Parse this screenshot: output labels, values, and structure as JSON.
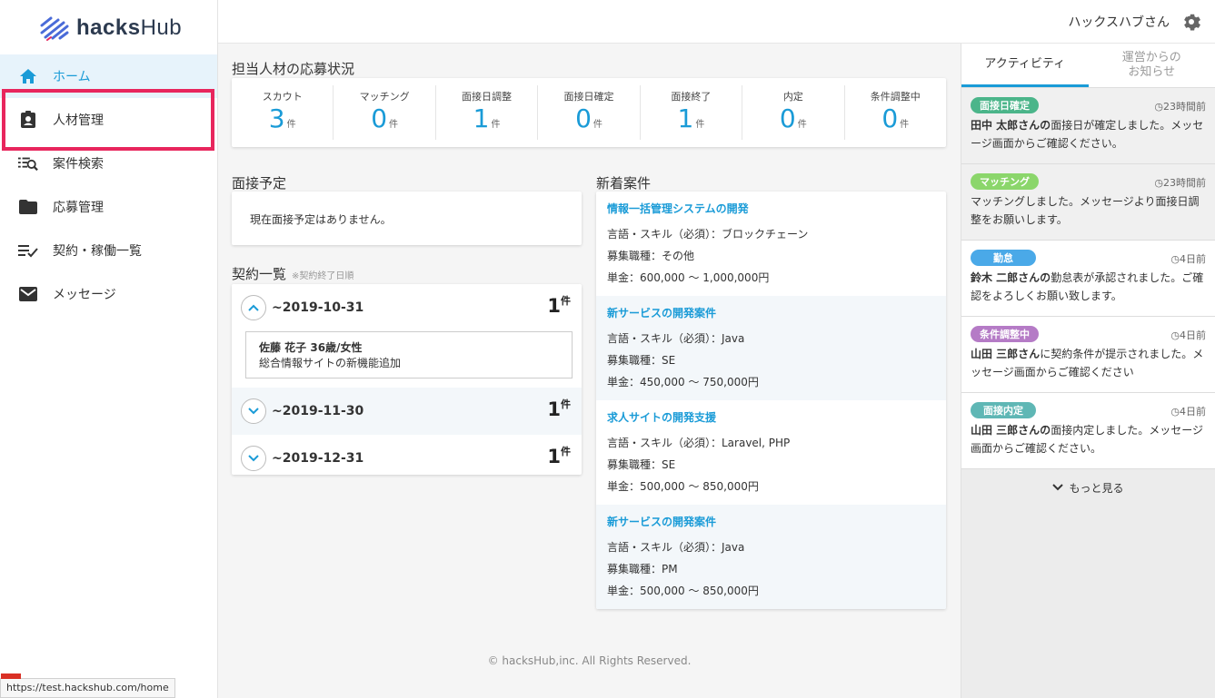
{
  "brand": {
    "name_bold": "hacks",
    "name_rest": "Hub"
  },
  "nav": [
    {
      "label": "ホーム",
      "icon": "home-icon",
      "active": true
    },
    {
      "label": "人材管理",
      "icon": "badge-icon"
    },
    {
      "label": "案件検索",
      "icon": "list-search-icon"
    },
    {
      "label": "応募管理",
      "icon": "folder-icon"
    },
    {
      "label": "契約・稼働一覧",
      "icon": "checklist-icon"
    },
    {
      "label": "メッセージ",
      "icon": "mail-icon"
    }
  ],
  "header": {
    "user": "ハックスハブさん"
  },
  "status": {
    "title": "担当人材の応募状況",
    "unit": "件",
    "items": [
      {
        "label": "スカウト",
        "value": "3"
      },
      {
        "label": "マッチング",
        "value": "0"
      },
      {
        "label": "面接日調整",
        "value": "1"
      },
      {
        "label": "面接日確定",
        "value": "0"
      },
      {
        "label": "面接終了",
        "value": "1"
      },
      {
        "label": "内定",
        "value": "0"
      },
      {
        "label": "条件調整中",
        "value": "0"
      }
    ]
  },
  "interview": {
    "title": "面接予定",
    "empty": "現在面接予定はありません。"
  },
  "contracts": {
    "title": "契約一覧",
    "note": "※契約終了日順",
    "unit": "件",
    "rows": [
      {
        "date": "~2019-10-31",
        "count": "1",
        "expanded": true,
        "detail_name": "佐藤 花子 36歳/女性",
        "detail_project": "総合情報サイトの新機能追加"
      },
      {
        "date": "~2019-11-30",
        "count": "1",
        "expanded": false
      },
      {
        "date": "~2019-12-31",
        "count": "1",
        "expanded": false
      }
    ]
  },
  "jobs": {
    "title": "新着案件",
    "items": [
      {
        "title": "情報一括管理システムの開発",
        "skill": "言語・スキル（必須）：ブロックチェーン",
        "role": "募集職種：その他",
        "price": "単金：600,000 ～ 1,000,000円"
      },
      {
        "title": "新サービスの開発案件",
        "skill": "言語・スキル（必須）：Java",
        "role": "募集職種：SE",
        "price": "単金：450,000 ～ 750,000円"
      },
      {
        "title": "求人サイトの開発支援",
        "skill": "言語・スキル（必須）：Laravel, PHP",
        "role": "募集職種：SE",
        "price": "単金：500,000 ～ 850,000円"
      },
      {
        "title": "新サービスの開発案件",
        "skill": "言語・スキル（必須）：Java",
        "role": "募集職種：PM",
        "price": "単金：500,000 ～ 850,000円"
      }
    ]
  },
  "footer": "© hacksHub,inc. All Rights Reserved.",
  "right_tabs": [
    {
      "label": "アクティビティ",
      "active": true
    },
    {
      "label": "運営からの\nお知らせ"
    }
  ],
  "activities": [
    {
      "badge": "面接日確定",
      "color": "#4bb58a",
      "time": "23時間前",
      "bold": "田中 太郎さんの",
      "text": "面接日が確定しました。メッセージ画面からご確認ください。",
      "gray": true
    },
    {
      "badge": "マッチング",
      "color": "#8bd66b",
      "time": "23時間前",
      "bold": "",
      "text": "マッチングしました。メッセージより面接日調整をお願いします。",
      "gray": true
    },
    {
      "badge": "勤怠",
      "color": "#4aa9e8",
      "time": "4日前",
      "bold": "鈴木 二郎さんの",
      "text": "勤怠表が承認されました。ご確認をよろしくお願い致します。"
    },
    {
      "badge": "条件調整中",
      "color": "#b57bc6",
      "time": "4日前",
      "bold": "山田 三郎さん",
      "text": "に契約条件が提示されました。メッセージ画面からご確認ください"
    },
    {
      "badge": "面接内定",
      "color": "#5fb7b5",
      "time": "4日前",
      "bold": "山田 三郎さんの",
      "text": "面接内定しました。メッセージ画面からご確認ください。"
    }
  ],
  "more": "もっと見る",
  "status_url": "https://test.hackshub.com/home"
}
